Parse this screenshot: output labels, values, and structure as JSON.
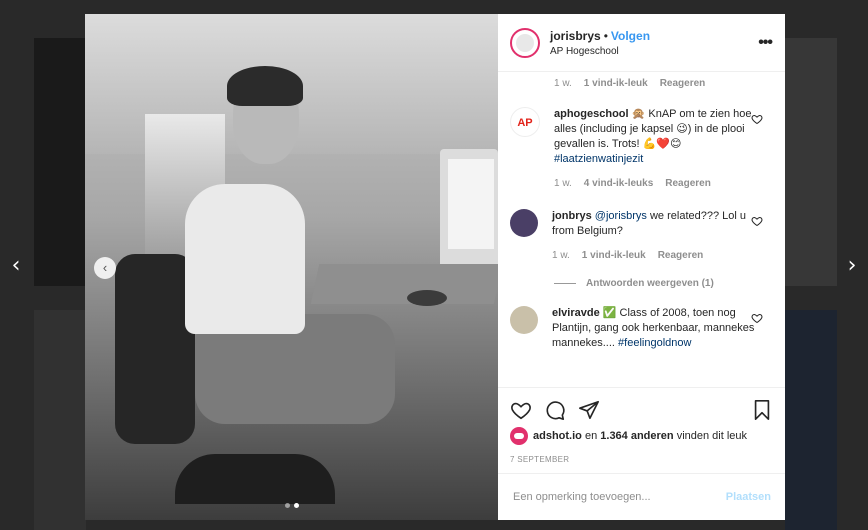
{
  "post": {
    "username": "jorisbrys",
    "separator": "•",
    "follow_label": "Volgen",
    "location": "AP Hogeschool",
    "more_label": "•••"
  },
  "navigation": {
    "prev_label": "‹",
    "next_label": "›",
    "photo_prev_label": "‹"
  },
  "comments": {
    "first_meta": {
      "age": "1 w.",
      "likes": "1 vind-ik-leuk",
      "reply": "Reageren"
    },
    "items": [
      {
        "user": "aphogeschool",
        "text_a": "🙊 KnAP om te zien hoe alles (including je kapsel 😉) in de plooi gevallen is. Trots! 💪❤️😊 ",
        "tag": "#laatzienwatinjezit",
        "age": "1 w.",
        "likes": "4 vind-ik-leuks",
        "reply": "Reageren"
      },
      {
        "user": "jonbrys",
        "mention": "@jorisbrys",
        "text_a": " we related??? Lol u from Belgium?",
        "age": "1 w.",
        "likes": "1 vind-ik-leuk",
        "reply": "Reageren",
        "view_replies": "Antwoorden weergeven (1)"
      },
      {
        "user": "elviravde",
        "text_a": "✅ Class of 2008, toen nog Plantijn, gang ook herkenbaar, mannekes mannekes.... ",
        "tag": "#feelingoldnow"
      }
    ]
  },
  "likes": {
    "liker": "adshot.io",
    "joiner": "en",
    "count": "1.364 anderen",
    "suffix": "vinden dit leuk"
  },
  "date": "7 SEPTEMBER",
  "comment_input": {
    "placeholder": "Een opmerking toevoegen...",
    "post_label": "Plaatsen"
  },
  "colors": {
    "accent": "#3897f0",
    "link": "#003569",
    "muted": "#8e8e8e",
    "brand_red": "#e1306c"
  },
  "icons": [
    "heart-icon",
    "comment-icon",
    "share-icon",
    "bookmark-icon",
    "more-icon"
  ]
}
